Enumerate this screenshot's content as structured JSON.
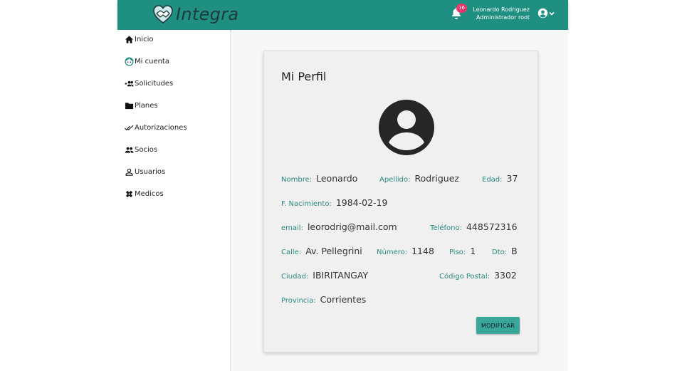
{
  "header": {
    "brand_name": "Integra",
    "notifications_count": "16",
    "user_name": "Leonardo Rodriguez",
    "user_role": "Administrador root"
  },
  "sidebar": {
    "items": [
      {
        "label": "Inicio",
        "icon": "home-icon"
      },
      {
        "label": "Mi cuenta",
        "icon": "face-icon"
      },
      {
        "label": "Solicitudes",
        "icon": "group-add-icon"
      },
      {
        "label": "Planes",
        "icon": "folder-icon"
      },
      {
        "label": "Autorizaciones",
        "icon": "double-check-icon"
      },
      {
        "label": "Socios",
        "icon": "people-icon"
      },
      {
        "label": "Usuarios",
        "icon": "person-outline-icon"
      },
      {
        "label": "Medicos",
        "icon": "healing-icon"
      }
    ]
  },
  "profile": {
    "title": "Mi Perfil",
    "nombre_label": "Nombre:",
    "nombre": "Leonardo",
    "apellido_label": "Apellido:",
    "apellido": "Rodriguez",
    "edad_label": "Edad:",
    "edad": "37",
    "nacimiento_label": "F. Nacimiento:",
    "nacimiento": "1984-02-19",
    "email_label": "email:",
    "email": "leorodrig@mail.com",
    "telefono_label": "Teléfono:",
    "telefono": "448572316",
    "calle_label": "Calle:",
    "calle": "Av. Pellegrini",
    "numero_label": "Número:",
    "numero": "1148",
    "piso_label": "Piso:",
    "piso": "1",
    "dto_label": "Dto:",
    "dto": "B",
    "ciudad_label": "Ciudad:",
    "ciudad": "IBIRITANGAY",
    "cp_label": "Código Postal:",
    "cp": "3302",
    "provincia_label": "Provincia:",
    "provincia": "Corrientes",
    "modify_label": "MODIFICAR"
  },
  "colors": {
    "header": "#1f8f82",
    "accent": "#3aa79b",
    "badge": "#e8336b"
  }
}
